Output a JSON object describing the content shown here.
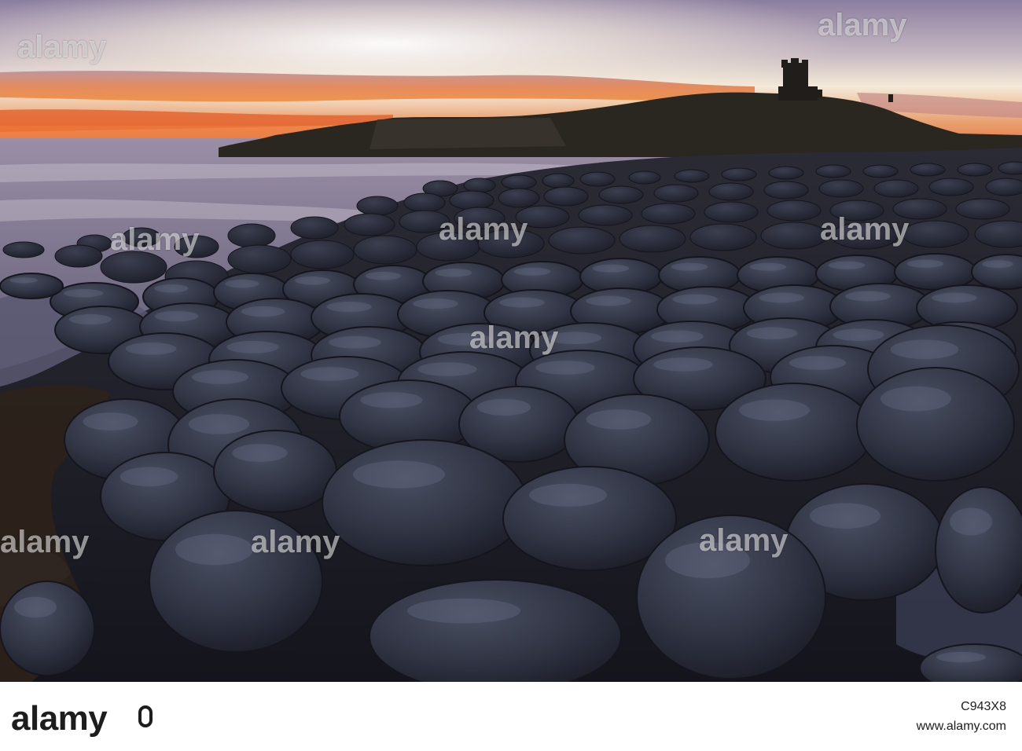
{
  "watermark": {
    "text": "alamy"
  },
  "footer": {
    "logo": "alamy",
    "image_id": "C943X8",
    "url": "www.alamy.com"
  },
  "colors": {
    "sky_top": "#8a7ea0",
    "sky_glow": "#f4ead8",
    "sunset_orange": "#e8632a",
    "sea": "#7b7690",
    "headland": "#2a2620",
    "boulder": "#2f3342",
    "footer_bg": "#ffffff",
    "footer_text": "#1d1d1d"
  },
  "icons": {
    "watermark_mark": "alamy-drop-icon",
    "footer_mark": "alamy-drop-icon"
  }
}
